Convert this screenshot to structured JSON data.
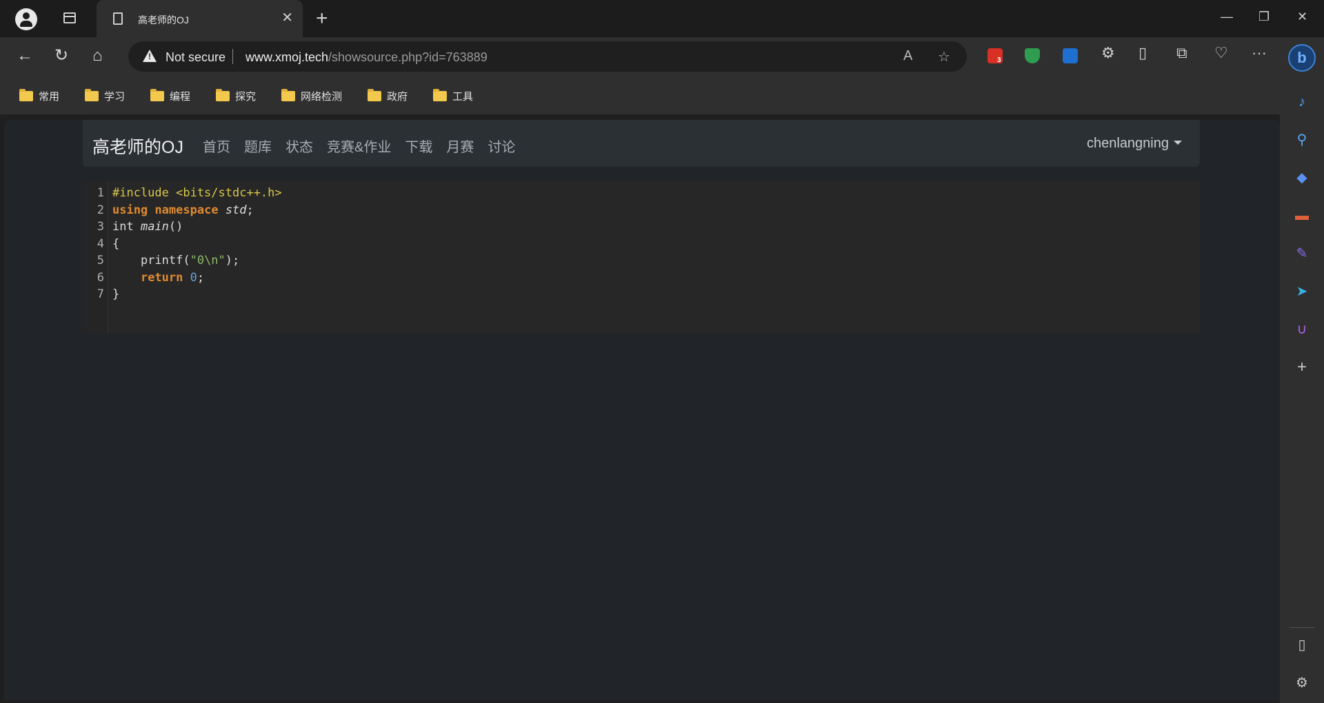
{
  "browser": {
    "tab_title": "高老师的OJ",
    "address": {
      "security_label": "Not secure",
      "host": "www.xmoj.tech",
      "path": "/showsource.php?id=763889"
    },
    "extension_badge": "3",
    "bookmarks": [
      "常用",
      "学习",
      "编程",
      "探究",
      "网络检测",
      "政府",
      "工具"
    ]
  },
  "site": {
    "brand": "高老师的OJ",
    "nav": [
      "首页",
      "题库",
      "状态",
      "竞赛&作业",
      "下载",
      "月赛",
      "讨论"
    ],
    "user": "chenlangning"
  },
  "code": {
    "line_numbers": [
      "1",
      "2",
      "3",
      "4",
      "5",
      "6",
      "7"
    ],
    "lines": [
      [
        {
          "t": "#include <bits/stdc++.h>",
          "c": "pp"
        }
      ],
      [
        {
          "t": "using",
          "c": "kw"
        },
        {
          "t": " ",
          "c": ""
        },
        {
          "t": "namespace",
          "c": "kw"
        },
        {
          "t": " ",
          "c": ""
        },
        {
          "t": "std",
          "c": "it"
        },
        {
          "t": ";",
          "c": ""
        }
      ],
      [
        {
          "t": "int ",
          "c": ""
        },
        {
          "t": "main",
          "c": "it"
        },
        {
          "t": "()",
          "c": ""
        }
      ],
      [
        {
          "t": "{",
          "c": ""
        }
      ],
      [
        {
          "t": "    printf(",
          "c": ""
        },
        {
          "t": "\"0\\n\"",
          "c": "str"
        },
        {
          "t": ");",
          "c": ""
        }
      ],
      [
        {
          "t": "    ",
          "c": ""
        },
        {
          "t": "return",
          "c": "kw"
        },
        {
          "t": " ",
          "c": ""
        },
        {
          "t": "0",
          "c": "num"
        },
        {
          "t": ";",
          "c": ""
        }
      ],
      [
        {
          "t": "}",
          "c": ""
        }
      ]
    ]
  },
  "colors": {
    "page_bg": "#212529",
    "navbar_bg": "#2b3035",
    "keyword": "#e08a30",
    "preprocessor": "#d9c84a",
    "string": "#8fb86b",
    "number": "#6a9fd8"
  },
  "icons": {
    "sidebar": [
      "bell-icon",
      "search-icon",
      "tag-icon",
      "toolbox-icon",
      "edit-icon",
      "send-icon",
      "magnet-icon",
      "add-icon"
    ],
    "sidebar_bottom": [
      "sidebar-layout-icon",
      "settings-icon"
    ]
  }
}
